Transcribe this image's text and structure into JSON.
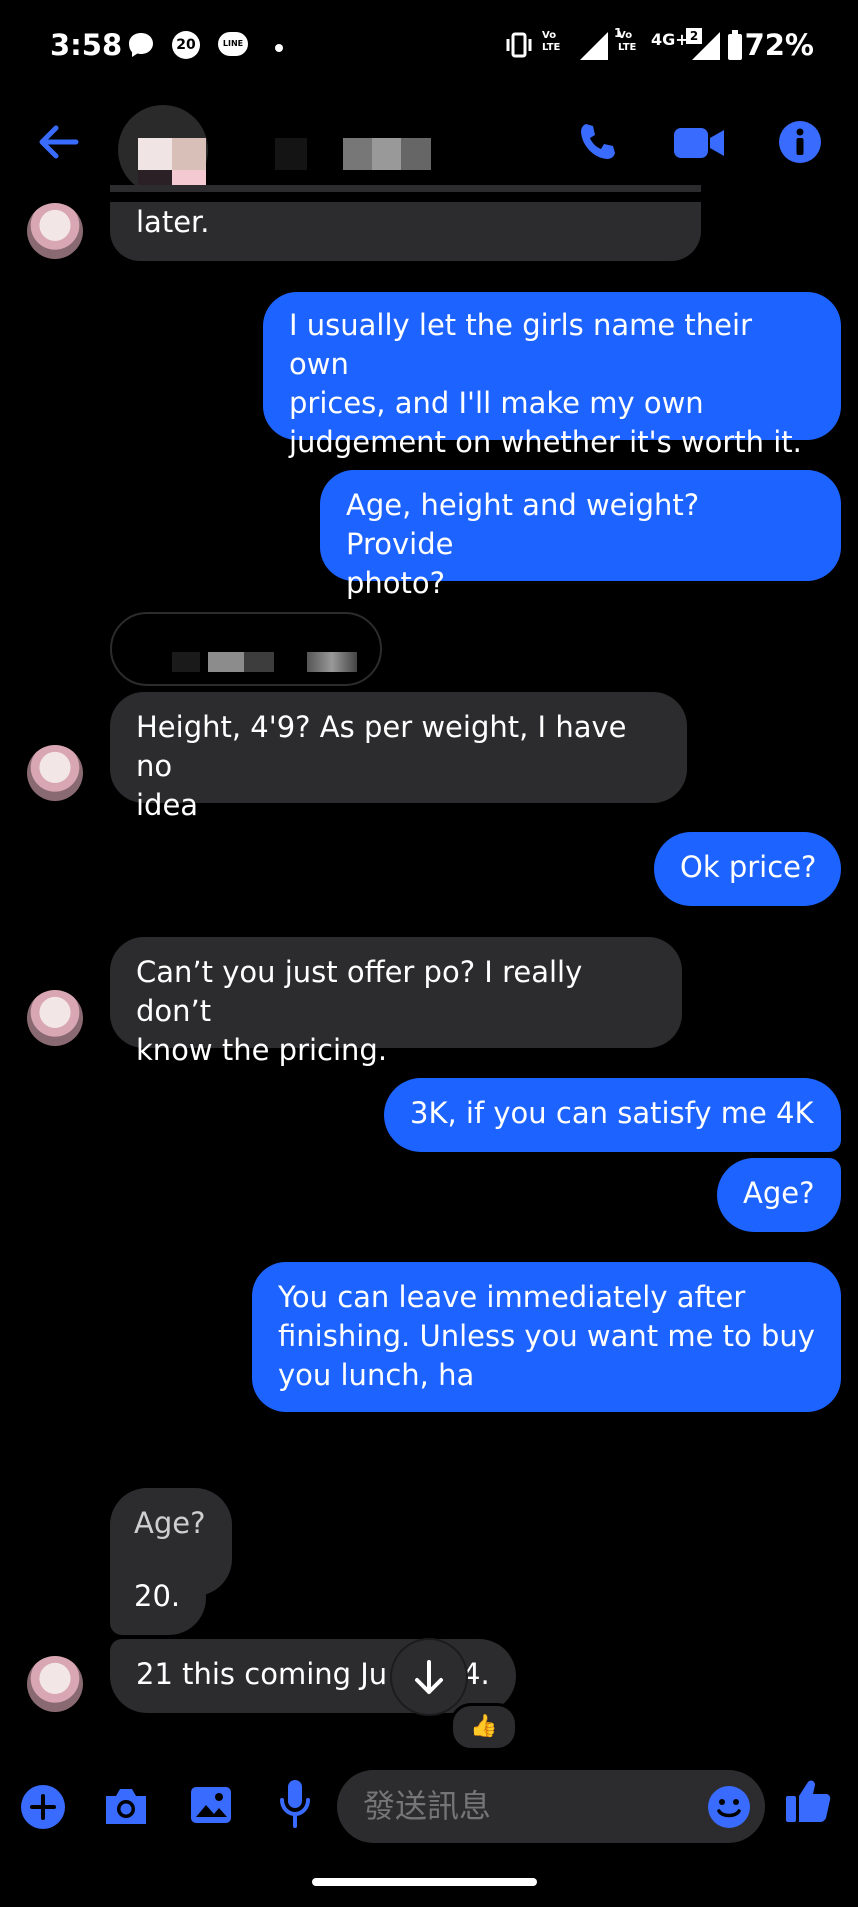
{
  "status_bar": {
    "time": "3:58",
    "battery": "72%",
    "network": "4G+",
    "sim1_badge": "1",
    "sim2_badge": "2",
    "app_badge": "20",
    "line_label": "LINE"
  },
  "header": {
    "icons": [
      "back-arrow-icon",
      "phone-icon",
      "video-camera-icon",
      "info-icon"
    ]
  },
  "messages": [
    {
      "from": "them",
      "text": "later."
    },
    {
      "from": "me",
      "lines": [
        "I usually let the girls name their own",
        "prices, and I'll make my own",
        "judgement on whether it's worth it."
      ]
    },
    {
      "from": "me",
      "lines": [
        "Age, height and weight? Provide",
        "photo?"
      ]
    },
    {
      "from": "them",
      "lines": [
        "Height, 4'9? As per weight, I have no",
        "idea"
      ]
    },
    {
      "from": "me",
      "text": "Ok price?"
    },
    {
      "from": "them",
      "lines": [
        "Can’t you just offer po? I really don’t",
        "know the pricing."
      ]
    },
    {
      "from": "me",
      "text": "3K, if you can satisfy me 4K"
    },
    {
      "from": "me",
      "text": "Age?"
    },
    {
      "from": "me",
      "lines": [
        "You can leave immediately after",
        "finishing. Unless you want me to buy",
        "you lunch, ha"
      ]
    },
    {
      "from": "them",
      "text": "Age?"
    },
    {
      "from": "them",
      "text": "20."
    },
    {
      "from": "them",
      "text": "21 this coming Ju",
      "text_tail": "4.",
      "reaction": "👍"
    }
  ],
  "composer": {
    "placeholder": "發送訊息",
    "icons": [
      "plus-icon",
      "camera-icon",
      "gallery-icon",
      "microphone-icon",
      "emoji-icon",
      "thumbs-up-icon"
    ]
  },
  "colors": {
    "background": "#000000",
    "accent": "#1d63ff",
    "incoming_bubble": "#2c2c2e",
    "icon_blue": "#3a6bff"
  }
}
